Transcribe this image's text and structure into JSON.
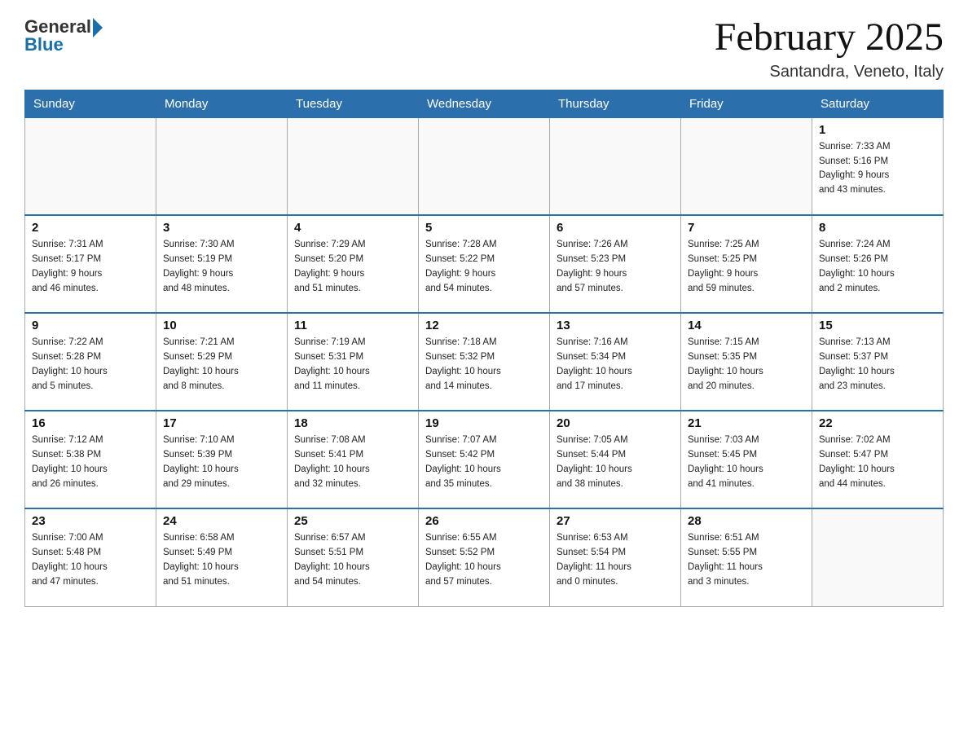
{
  "header": {
    "logo_general": "General",
    "logo_blue": "Blue",
    "month_title": "February 2025",
    "subtitle": "Santandra, Veneto, Italy"
  },
  "weekdays": [
    "Sunday",
    "Monday",
    "Tuesday",
    "Wednesday",
    "Thursday",
    "Friday",
    "Saturday"
  ],
  "weeks": [
    [
      {
        "day": "",
        "info": ""
      },
      {
        "day": "",
        "info": ""
      },
      {
        "day": "",
        "info": ""
      },
      {
        "day": "",
        "info": ""
      },
      {
        "day": "",
        "info": ""
      },
      {
        "day": "",
        "info": ""
      },
      {
        "day": "1",
        "info": "Sunrise: 7:33 AM\nSunset: 5:16 PM\nDaylight: 9 hours\nand 43 minutes."
      }
    ],
    [
      {
        "day": "2",
        "info": "Sunrise: 7:31 AM\nSunset: 5:17 PM\nDaylight: 9 hours\nand 46 minutes."
      },
      {
        "day": "3",
        "info": "Sunrise: 7:30 AM\nSunset: 5:19 PM\nDaylight: 9 hours\nand 48 minutes."
      },
      {
        "day": "4",
        "info": "Sunrise: 7:29 AM\nSunset: 5:20 PM\nDaylight: 9 hours\nand 51 minutes."
      },
      {
        "day": "5",
        "info": "Sunrise: 7:28 AM\nSunset: 5:22 PM\nDaylight: 9 hours\nand 54 minutes."
      },
      {
        "day": "6",
        "info": "Sunrise: 7:26 AM\nSunset: 5:23 PM\nDaylight: 9 hours\nand 57 minutes."
      },
      {
        "day": "7",
        "info": "Sunrise: 7:25 AM\nSunset: 5:25 PM\nDaylight: 9 hours\nand 59 minutes."
      },
      {
        "day": "8",
        "info": "Sunrise: 7:24 AM\nSunset: 5:26 PM\nDaylight: 10 hours\nand 2 minutes."
      }
    ],
    [
      {
        "day": "9",
        "info": "Sunrise: 7:22 AM\nSunset: 5:28 PM\nDaylight: 10 hours\nand 5 minutes."
      },
      {
        "day": "10",
        "info": "Sunrise: 7:21 AM\nSunset: 5:29 PM\nDaylight: 10 hours\nand 8 minutes."
      },
      {
        "day": "11",
        "info": "Sunrise: 7:19 AM\nSunset: 5:31 PM\nDaylight: 10 hours\nand 11 minutes."
      },
      {
        "day": "12",
        "info": "Sunrise: 7:18 AM\nSunset: 5:32 PM\nDaylight: 10 hours\nand 14 minutes."
      },
      {
        "day": "13",
        "info": "Sunrise: 7:16 AM\nSunset: 5:34 PM\nDaylight: 10 hours\nand 17 minutes."
      },
      {
        "day": "14",
        "info": "Sunrise: 7:15 AM\nSunset: 5:35 PM\nDaylight: 10 hours\nand 20 minutes."
      },
      {
        "day": "15",
        "info": "Sunrise: 7:13 AM\nSunset: 5:37 PM\nDaylight: 10 hours\nand 23 minutes."
      }
    ],
    [
      {
        "day": "16",
        "info": "Sunrise: 7:12 AM\nSunset: 5:38 PM\nDaylight: 10 hours\nand 26 minutes."
      },
      {
        "day": "17",
        "info": "Sunrise: 7:10 AM\nSunset: 5:39 PM\nDaylight: 10 hours\nand 29 minutes."
      },
      {
        "day": "18",
        "info": "Sunrise: 7:08 AM\nSunset: 5:41 PM\nDaylight: 10 hours\nand 32 minutes."
      },
      {
        "day": "19",
        "info": "Sunrise: 7:07 AM\nSunset: 5:42 PM\nDaylight: 10 hours\nand 35 minutes."
      },
      {
        "day": "20",
        "info": "Sunrise: 7:05 AM\nSunset: 5:44 PM\nDaylight: 10 hours\nand 38 minutes."
      },
      {
        "day": "21",
        "info": "Sunrise: 7:03 AM\nSunset: 5:45 PM\nDaylight: 10 hours\nand 41 minutes."
      },
      {
        "day": "22",
        "info": "Sunrise: 7:02 AM\nSunset: 5:47 PM\nDaylight: 10 hours\nand 44 minutes."
      }
    ],
    [
      {
        "day": "23",
        "info": "Sunrise: 7:00 AM\nSunset: 5:48 PM\nDaylight: 10 hours\nand 47 minutes."
      },
      {
        "day": "24",
        "info": "Sunrise: 6:58 AM\nSunset: 5:49 PM\nDaylight: 10 hours\nand 51 minutes."
      },
      {
        "day": "25",
        "info": "Sunrise: 6:57 AM\nSunset: 5:51 PM\nDaylight: 10 hours\nand 54 minutes."
      },
      {
        "day": "26",
        "info": "Sunrise: 6:55 AM\nSunset: 5:52 PM\nDaylight: 10 hours\nand 57 minutes."
      },
      {
        "day": "27",
        "info": "Sunrise: 6:53 AM\nSunset: 5:54 PM\nDaylight: 11 hours\nand 0 minutes."
      },
      {
        "day": "28",
        "info": "Sunrise: 6:51 AM\nSunset: 5:55 PM\nDaylight: 11 hours\nand 3 minutes."
      },
      {
        "day": "",
        "info": ""
      }
    ]
  ]
}
